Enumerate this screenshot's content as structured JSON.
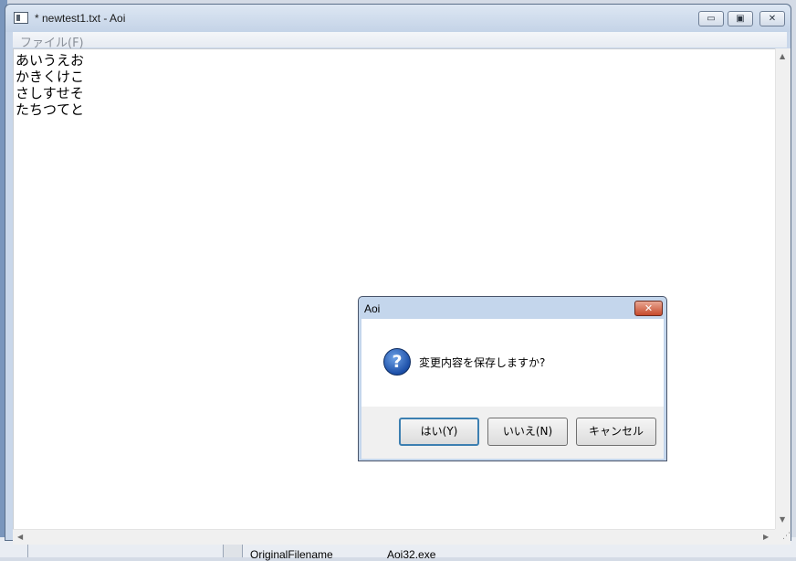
{
  "background": {
    "bottom_texts": [
      "OriginalFilename",
      "Aoi32.exe"
    ]
  },
  "window": {
    "title": "* newtest1.txt - Aoi",
    "controls": {
      "minimize": "▭",
      "maximize": "▣",
      "close": "✕"
    },
    "menu": [
      {
        "label": "ファイル(F)"
      }
    ]
  },
  "editor": {
    "lines": [
      "あいうえお",
      "かきくけこ",
      "さしすせそ",
      "たちつてと"
    ]
  },
  "dialog": {
    "title": "Aoi",
    "close": "✕",
    "icon": "question-icon",
    "message": "変更内容を保存しますか?",
    "buttons": {
      "yes": "はい(Y)",
      "no": "いいえ(N)",
      "cancel": "キャンセル"
    }
  },
  "colors": {
    "titlebar": "#c4d3e7",
    "dialog_close": "#c64a2c",
    "default_button_border": "#3c7fb1"
  }
}
